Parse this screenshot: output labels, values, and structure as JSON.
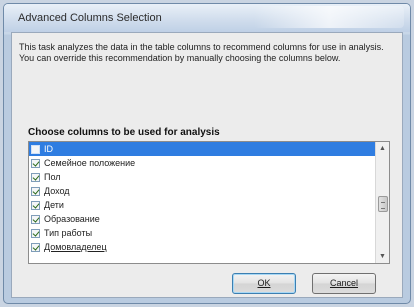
{
  "window": {
    "title": "Advanced Columns Selection"
  },
  "description": "This task analyzes the data in the table columns to recommend columns for use in analysis. You can override this recommendation by manually choosing the columns below.",
  "section_label": "Choose columns to be used for analysis",
  "columns": [
    {
      "label": "ID",
      "checked": false,
      "selected": true
    },
    {
      "label": "Семейное положение",
      "checked": true,
      "selected": false
    },
    {
      "label": "Пол",
      "checked": true,
      "selected": false
    },
    {
      "label": "Доход",
      "checked": true,
      "selected": false
    },
    {
      "label": "Дети",
      "checked": true,
      "selected": false
    },
    {
      "label": "Образование",
      "checked": true,
      "selected": false
    },
    {
      "label": "Тип работы",
      "checked": true,
      "selected": false
    },
    {
      "label": "Домовладелец",
      "checked": true,
      "selected": false
    }
  ],
  "buttons": {
    "ok": "OK",
    "cancel": "Cancel"
  },
  "colors": {
    "selection": "#2f7de1",
    "default_button_border": "#3c7fb1"
  }
}
